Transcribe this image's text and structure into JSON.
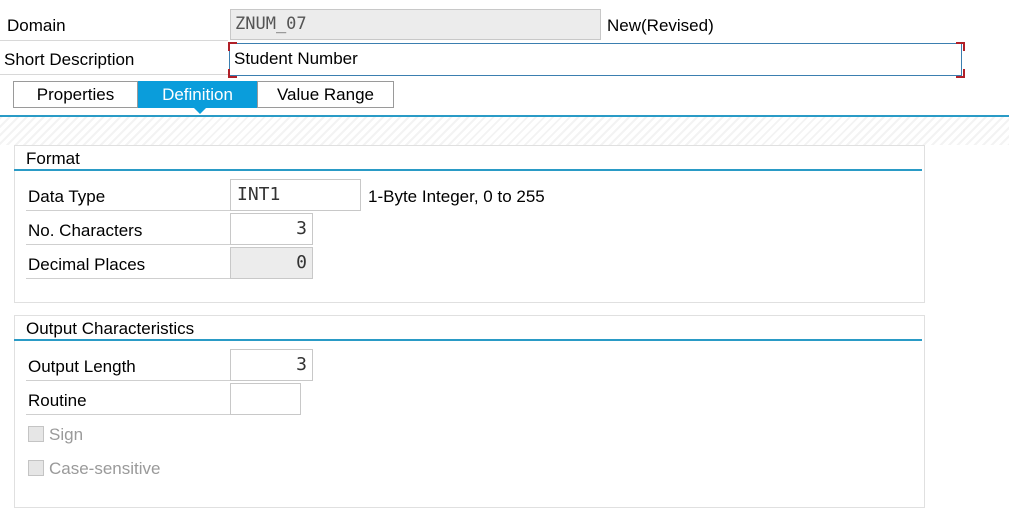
{
  "header": {
    "domain_label": "Domain",
    "domain_value": "ZNUM_07",
    "status": "New(Revised)",
    "short_desc_label": "Short Description",
    "short_desc_value": "Student Number"
  },
  "tabs": [
    {
      "label": "Properties",
      "active": false
    },
    {
      "label": "Definition",
      "active": true
    },
    {
      "label": "Value Range",
      "active": false
    }
  ],
  "format": {
    "title": "Format",
    "data_type_label": "Data Type",
    "data_type_value": "INT1",
    "data_type_desc": "1-Byte Integer, 0 to 255",
    "no_chars_label": "No. Characters",
    "no_chars_value": "3",
    "decimal_label": "Decimal Places",
    "decimal_value": "0"
  },
  "output": {
    "title": "Output Characteristics",
    "output_length_label": "Output Length",
    "output_length_value": "3",
    "routine_label": "Routine",
    "routine_value": "",
    "sign_label": "Sign",
    "case_label": "Case-sensitive"
  },
  "colors": {
    "accent": "#0a9ddb",
    "line": "#2a9bc6",
    "required_corner": "#b02028"
  }
}
